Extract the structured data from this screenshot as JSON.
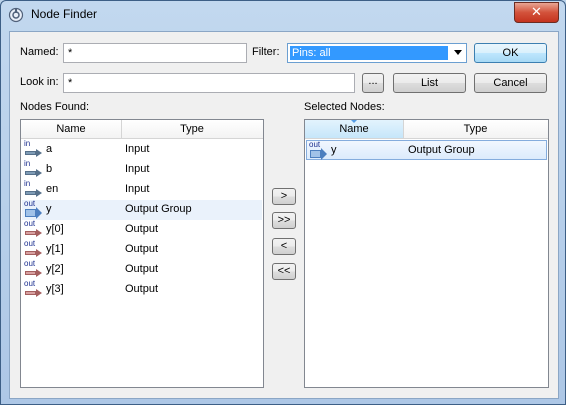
{
  "window": {
    "title": "Node Finder",
    "close_label": "✕"
  },
  "labels": {
    "named": "Named:",
    "filter": "Filter:",
    "look_in": "Look in:",
    "nodes_found": "Nodes Found:",
    "selected_nodes": "Selected Nodes:"
  },
  "named_value": "*",
  "look_in_value": "*",
  "filter_value": "Pins: all",
  "buttons": {
    "ok": "OK",
    "cancel": "Cancel",
    "list": "List",
    "browse": "...",
    "add": ">",
    "add_all": ">>",
    "remove": "<",
    "remove_all": "<<"
  },
  "columns": {
    "name": "Name",
    "type": "Type"
  },
  "nodes_found": [
    {
      "tag": "in",
      "name": "a",
      "type": "Input"
    },
    {
      "tag": "in",
      "name": "b",
      "type": "Input"
    },
    {
      "tag": "in",
      "name": "en",
      "type": "Input"
    },
    {
      "tag": "out",
      "name": "y",
      "type": "Output Group"
    },
    {
      "tag": "out",
      "name": "y[0]",
      "type": "Output"
    },
    {
      "tag": "out",
      "name": "y[1]",
      "type": "Output"
    },
    {
      "tag": "out",
      "name": "y[2]",
      "type": "Output"
    },
    {
      "tag": "out",
      "name": "y[3]",
      "type": "Output"
    }
  ],
  "selected_nodes": [
    {
      "tag": "out",
      "name": "y",
      "type": "Output Group"
    }
  ]
}
